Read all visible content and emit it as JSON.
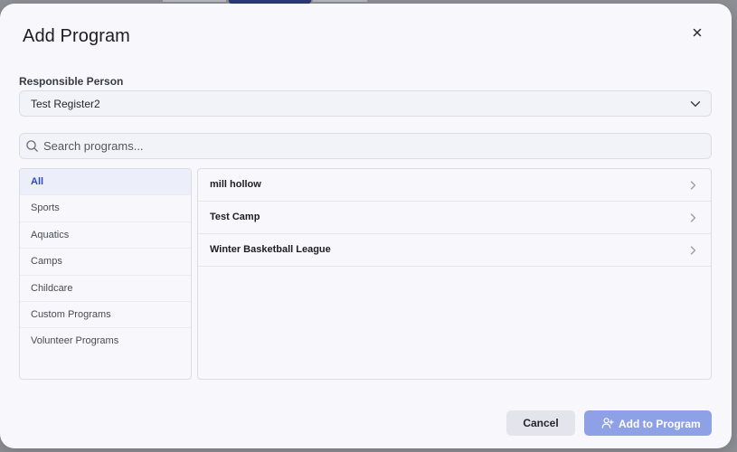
{
  "dialog": {
    "title": "Add Program",
    "close_icon": "close-icon"
  },
  "responsible_person": {
    "label": "Responsible Person",
    "value": "Test Register2",
    "icon": "chevron-down-icon"
  },
  "search": {
    "placeholder": "Search programs...",
    "value": "",
    "icon": "search-icon"
  },
  "categories": [
    {
      "label": "All",
      "active": true
    },
    {
      "label": "Sports",
      "active": false
    },
    {
      "label": "Aquatics",
      "active": false
    },
    {
      "label": "Camps",
      "active": false
    },
    {
      "label": "Childcare",
      "active": false
    },
    {
      "label": "Custom Programs",
      "active": false
    },
    {
      "label": "Volunteer Programs",
      "active": false
    }
  ],
  "programs": [
    {
      "name": "mill hollow",
      "icon": "chevron-right-icon"
    },
    {
      "name": "Test Camp",
      "icon": "chevron-right-icon"
    },
    {
      "name": "Winter Basketball League",
      "icon": "chevron-right-icon"
    }
  ],
  "footer": {
    "cancel_label": "Cancel",
    "add_label": "Add to Program",
    "add_icon": "add-user-icon"
  },
  "colors": {
    "accent": "#2a48c8",
    "primary_button_disabled": "#8fa1e6",
    "modal_background": "#f7f7fc"
  }
}
